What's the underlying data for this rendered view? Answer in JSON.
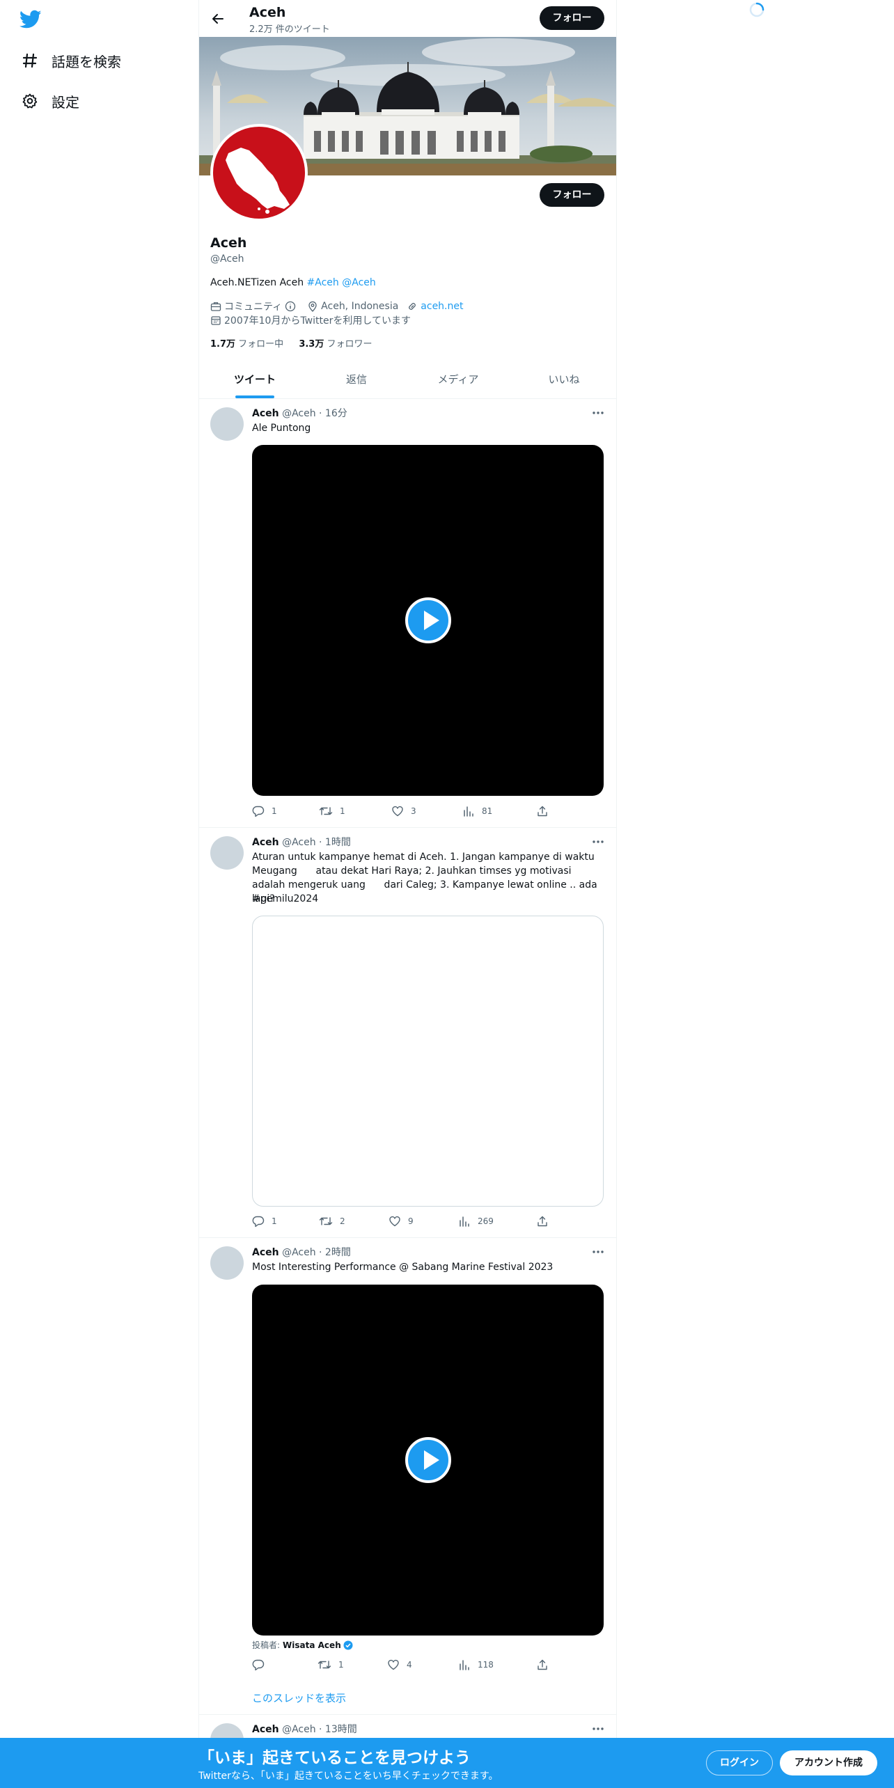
{
  "nav": {
    "items": [
      {
        "label": "話題を検索",
        "icon": "hashtag-icon"
      },
      {
        "label": "設定",
        "icon": "gear-icon"
      }
    ]
  },
  "header": {
    "name": "Aceh",
    "tweet_count": "2.2万 件のツイート",
    "follow_label": "フォロー"
  },
  "profile": {
    "name": "Aceh",
    "handle": "@Aceh",
    "follow_label": "フォロー",
    "bio_text": "Aceh.NETizen Aceh ",
    "bio_links": "#Aceh @Aceh",
    "category": "コミュニティ",
    "location": "Aceh, Indonesia",
    "website": "aceh.net",
    "joined": "2007年10月からTwitterを利用しています",
    "following_count": "1.7万",
    "following_label": "フォロー中",
    "followers_count": "3.3万",
    "followers_label": "フォロワー"
  },
  "tabs": [
    "ツイート",
    "返信",
    "メディア",
    "いいね"
  ],
  "tweets": [
    {
      "name": "Aceh",
      "meta": "@Aceh · 16分",
      "text": "Ale      Puntong",
      "reply": "1",
      "retweet": "1",
      "like": "3",
      "views": "81"
    },
    {
      "name": "Aceh",
      "meta": "@Aceh · 1時間",
      "text": "Aturan untuk kampanye hemat di Aceh. 1. Jangan kampanye di waktu Meugang      atau dekat Hari Raya; 2. Jauhkan timses yg motivasi adalah mengeruk uang      dari Caleg; 3. Kampanye lewat online .. ada lagi?",
      "hashtag": "#pemilu2024",
      "reply": "1",
      "retweet": "2",
      "like": "9",
      "views": "269"
    },
    {
      "name": "Aceh",
      "meta": "@Aceh · 2時間",
      "text": "Most Interesting Performance @ Sabang Marine Festival 2023",
      "poster_label": "投稿者:",
      "poster_name": "Wisata Aceh",
      "reply": "",
      "retweet": "1",
      "like": "4",
      "views": "118",
      "thread_label": "このスレッドを表示"
    },
    {
      "name": "Aceh",
      "meta": "@Aceh · 13時間"
    }
  ],
  "bottom": {
    "title": "「いま」起きていることを見つけよう",
    "subtitle": "Twitterなら、「いま」起きていることをいち早くチェックできます。",
    "login": "ログイン",
    "signup": "アカウント作成"
  },
  "colors": {
    "accent": "#1d9bf0",
    "dark": "#0f1419",
    "secondary": "#536471",
    "avatar_red": "#c8101a"
  }
}
